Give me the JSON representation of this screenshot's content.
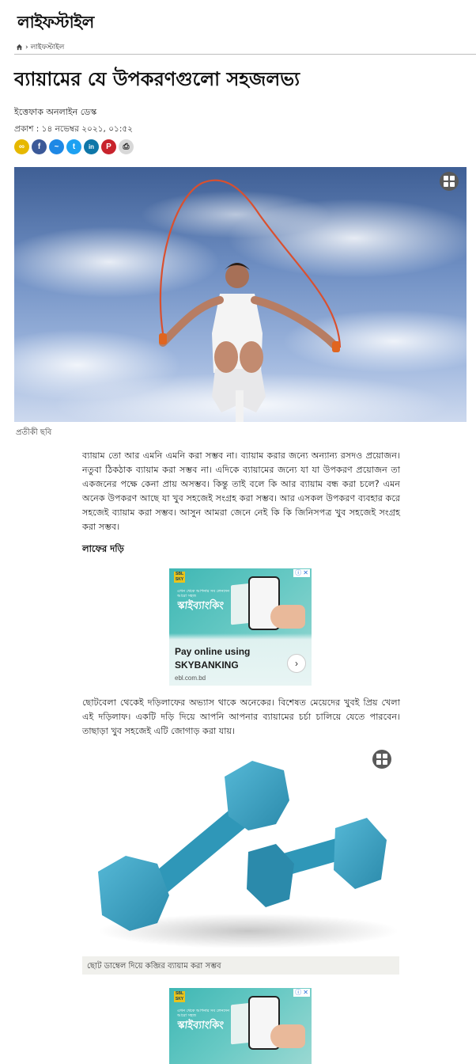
{
  "section": {
    "title": "লাইফস্টাইল"
  },
  "breadcrumb": {
    "home_icon": "home-icon",
    "separator": "›",
    "current": "লাইফস্টাইল"
  },
  "article": {
    "headline": "ব্যায়ামের যে উপকরণগুলো সহজলভ্য",
    "author": "ইত্তেফাক অনলাইন ডেস্ক",
    "published": "প্রকাশ : ১৪ নভেম্বর ২০২১, ০১:৫২",
    "hero_caption": "প্রতীকী ছবি",
    "intro": "ব্যায়াম তো আর এমনি এমনি করা সম্ভব না। ব্যায়াম করার জন্যে অন্যান্য রসদও প্রয়োজন। নতুবা ঠিকঠাক ব্যায়াম করা সম্ভব না। এদিকে ব্যায়ামের জন্যে যা যা উপকরণ প্রয়োজন তা একজনের পক্ষে কেনা প্রায় অসম্ভব। কিন্তু তাই বলে কি আর ব্যায়াম বন্ধ করা চলে? এমন অনেক উপকরণ আছে যা খুব সহজেই সংগ্রহ করা সম্ভব। আর এসকল উপকরণ ব্যবহার করে সহজেই ব্যায়াম করা সম্ভব। আসুন আমরা জেনে নেই কি কি জিনিসপত্র খুব সহজেই সংগ্রহ করা সম্ভব।",
    "subhead1": "লাফের দড়ি",
    "para2": "ছোটবেলা থেকেই দড়িলাফের অভ্যাস থাকে অনেকের। বিশেষত মেয়েদের খুবই প্রিয় খেলা এই দড়িলাফ। একটি দড়ি দিয়ে আপনি আপনার ব্যায়ামের চর্চা চালিয়ে যেতে পারবেন। তাছাড়া খুব সহজেই এটি জোগাড় করা যায়।",
    "image2_caption": "ছোট ডাম্বেল দিয়ে কব্জির ব্যায়াম করা সম্ভব"
  },
  "share_buttons": [
    {
      "icon": "link-icon",
      "color": "#e6b800",
      "glyph": "∞"
    },
    {
      "icon": "facebook-icon",
      "color": "#3b5998",
      "glyph": "f"
    },
    {
      "icon": "messenger-icon",
      "color": "#1e88e5",
      "glyph": "~"
    },
    {
      "icon": "twitter-icon",
      "color": "#1da1f2",
      "glyph": "t"
    },
    {
      "icon": "linkedin-icon",
      "color": "#0e76a8",
      "glyph": "in"
    },
    {
      "icon": "pinterest-icon",
      "color": "#c8232c",
      "glyph": "P"
    },
    {
      "icon": "print-icon",
      "color": "#d8d8d8",
      "glyph": "⎙"
    }
  ],
  "ad": {
    "logo": "SBL SKY",
    "tagline": "এখন থেকে আপনার সব লেনদেন আরো সহজ",
    "brand": "স্কাইব্যাংকিং",
    "cta": "Pay online using SKYBANKING",
    "url": "ebl.com.bd",
    "close": "ⓘ ✕",
    "arrow": "›"
  },
  "colors": {
    "accent": "#2a6fd8",
    "rule": "#bdbdbd",
    "ad_teal": "#3fb7b4",
    "dumbbell": "#3a9fc0"
  }
}
